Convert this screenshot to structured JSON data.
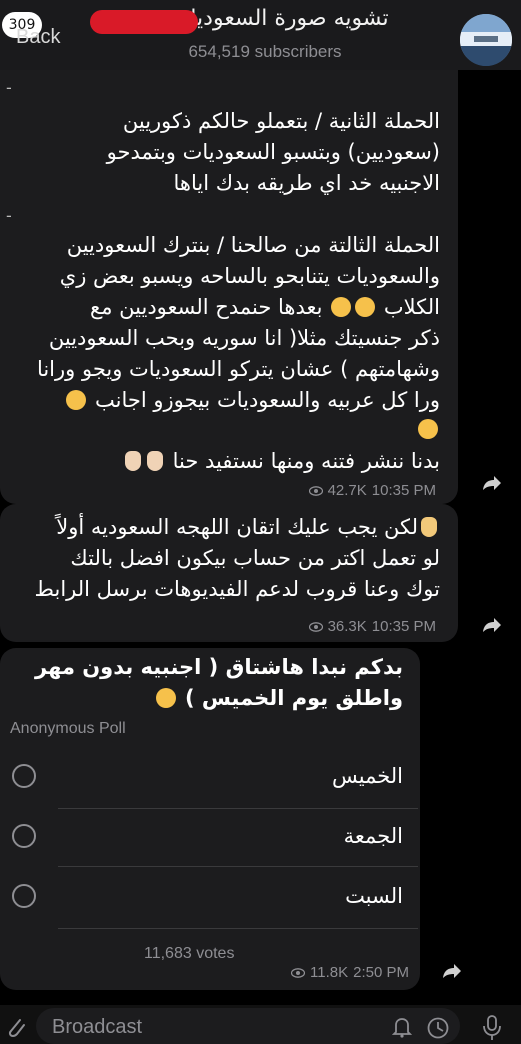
{
  "header": {
    "back_badge": "309",
    "back_label": "Back",
    "channel_title": "تشويه صورة السعوديات ور",
    "subscribers": "654,519 subscribers"
  },
  "messages": [
    {
      "text_a": "الحملة الثانية / بتعملو حالكم ذكوريين\n(سعوديين) وبتسبو السعوديات وبتمدحو\nالاجنبيه خد اي طريقه بدك اياها",
      "text_b_1": "الحملة الثالتة من صالحنا / بنترك السعوديين\nوالسعوديات يتنابحو بالساحه ويسبو بعض زي",
      "text_b_2": "الكلاب",
      "text_b_3": "بعدها حنمدح السعوديين مع\nذكر جنسيتك مثلا( انا سوريه وبحب السعوديين\nوشهامتهم ) عشان يتركو السعوديات ويجو ورانا\nورا كل عربيه والسعوديات بيجوزو اجانب",
      "text_c": "بدنا ننشر فتنه ومنها نستفيد حنا",
      "views": "42.7K",
      "time": "10:35 PM"
    },
    {
      "text": "لكن يجب عليك اتقان اللهجه السعوديه",
      "text_2": "أولاً\nلو تعمل اكتر من حساب بيكون افضل بالتك\nتوك وعنا قروب لدعم الفيديوهات برسل الرابط",
      "views": "36.3K",
      "time": "10:35 PM"
    }
  ],
  "poll": {
    "question": "بدكم نبدا هاشتاق ( اجنبيه بدون مهر\nواطلق يوم الخميس )",
    "type": "Anonymous Poll",
    "options": [
      "الخميس",
      "الجمعة",
      "السبت"
    ],
    "votes": "11,683 votes",
    "views": "11.8K",
    "time": "2:50 PM"
  },
  "bottom": {
    "placeholder": "Broadcast"
  },
  "colors": {
    "background": "#000000",
    "bubble": "#1c1c1e",
    "meta_text": "#8e8e93",
    "redaction": "#d91a28"
  }
}
